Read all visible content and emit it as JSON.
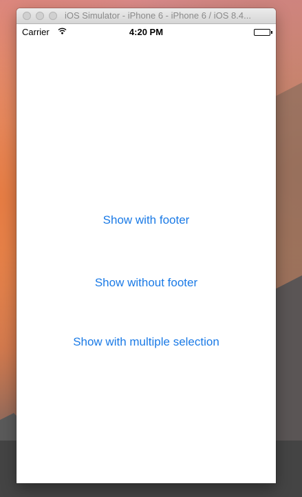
{
  "window": {
    "title": "iOS Simulator - iPhone 6 - iPhone 6 / iOS 8.4..."
  },
  "status_bar": {
    "carrier": "Carrier",
    "time": "4:20 PM"
  },
  "buttons": {
    "show_with_footer": "Show with footer",
    "show_without_footer": "Show without footer",
    "show_multiple_selection": "Show with multiple selection"
  },
  "colors": {
    "accent": "#1a7ae6"
  },
  "icons": [
    "wifi-icon",
    "battery-icon"
  ]
}
